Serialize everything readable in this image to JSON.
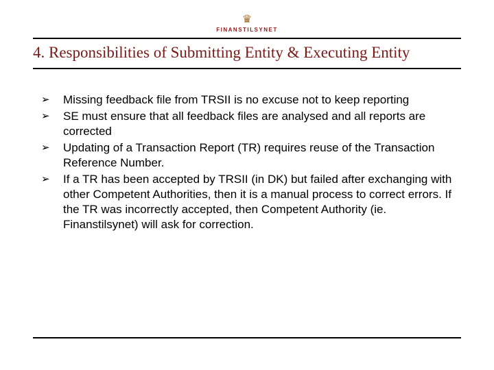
{
  "logo": {
    "crown_glyph": "♛",
    "org_name": "FINANSTILSYNET"
  },
  "heading": "4. Responsibilities of Submitting Entity & Executing Entity",
  "bullets": [
    "Missing feedback file from TRSII is no excuse not to keep reporting",
    "SE must ensure that all feedback files are analysed and all reports are corrected",
    "Updating of a Transaction Report (TR) requires reuse of the Transaction Reference Number.",
    "If a TR has been accepted by TRSII (in DK) but failed after exchanging with other Competent Authorities, then it is a manual process to correct errors. If the TR was incorrectly accepted, then Competent Authority (ie. Finanstilsynet) will ask for correction."
  ]
}
